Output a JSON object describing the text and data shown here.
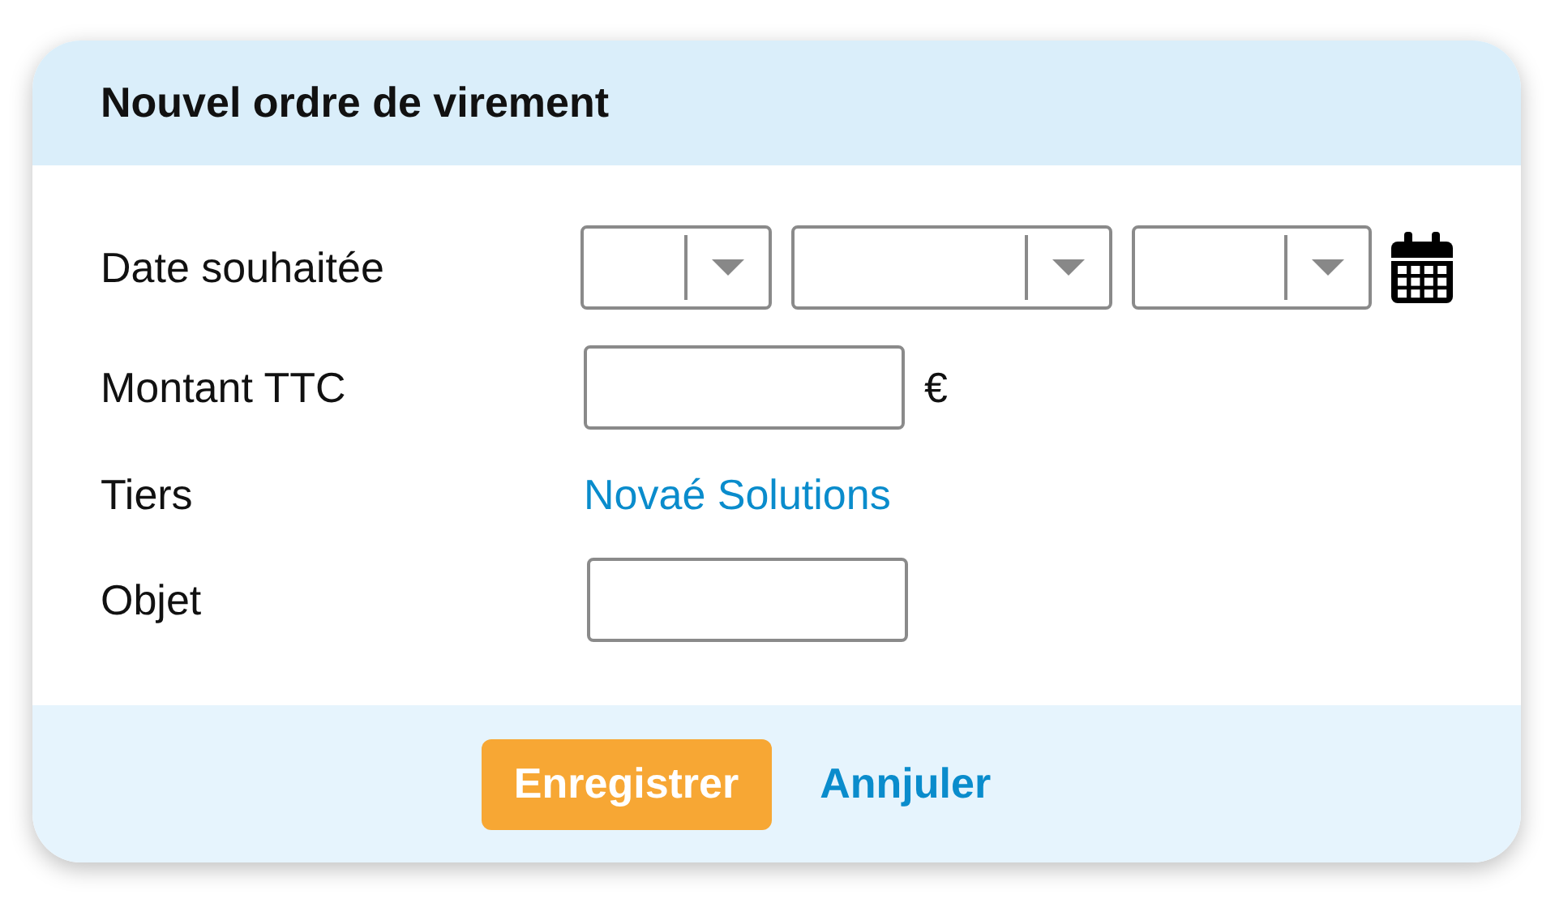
{
  "dialog": {
    "title": "Nouvel ordre de virement"
  },
  "fields": [
    {
      "kind": "date",
      "label": "Date souhaitée"
    },
    {
      "kind": "amount",
      "label": "Montant TTC",
      "unit": "€"
    },
    {
      "kind": "link",
      "label": "Tiers",
      "value": "Novaé Solutions"
    },
    {
      "kind": "text",
      "label": "Objet"
    }
  ],
  "actions": [
    {
      "kind": "primary",
      "label": "Enregistrer"
    },
    {
      "kind": "link",
      "label": "Annjuler"
    }
  ]
}
